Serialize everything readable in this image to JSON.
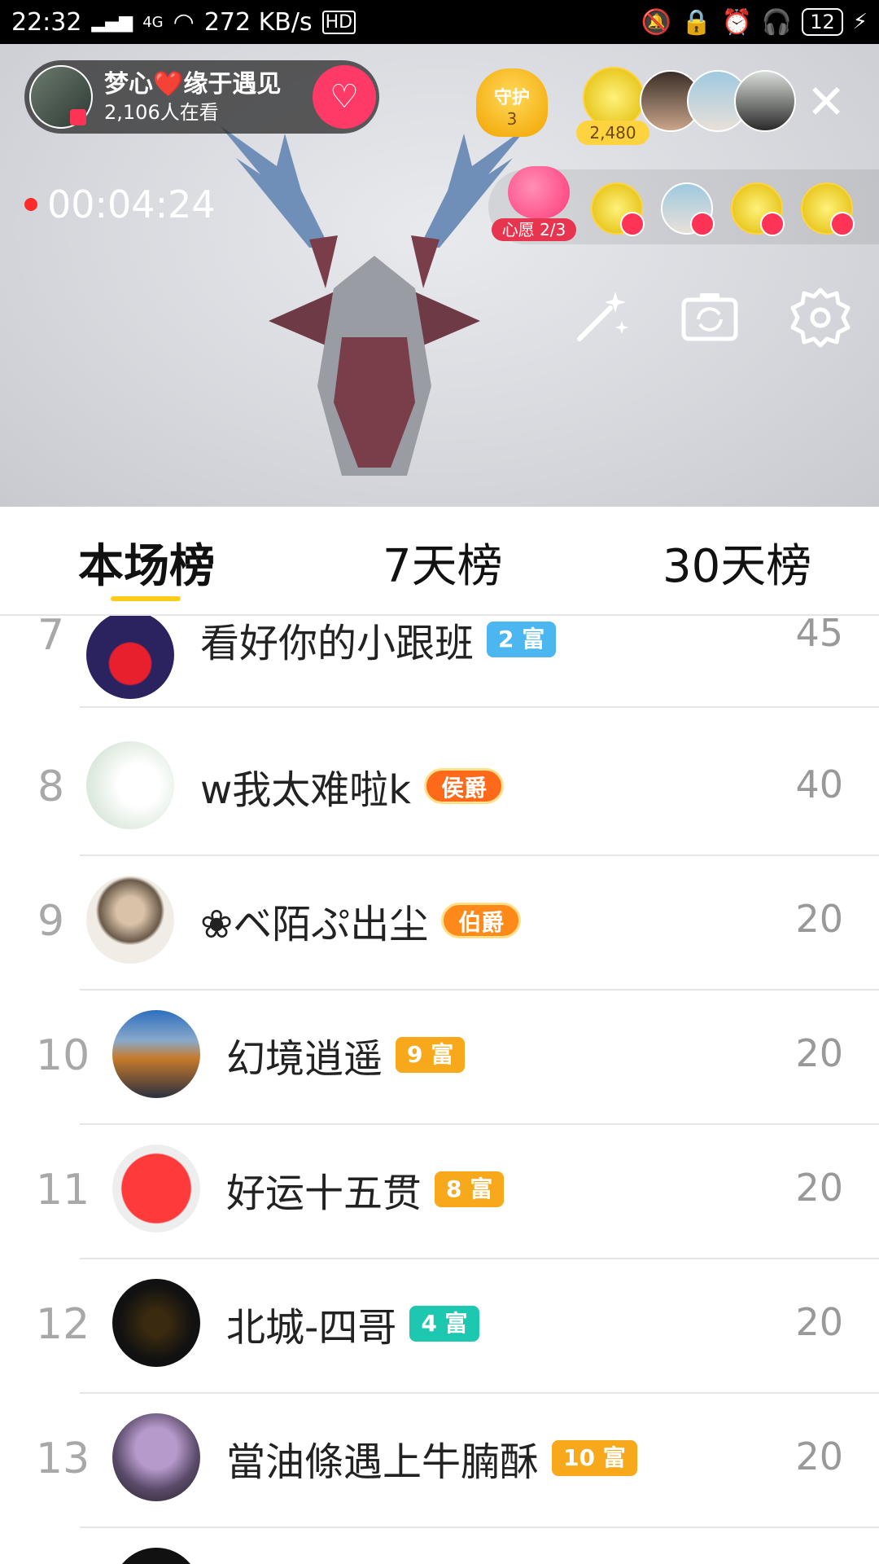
{
  "status_bar": {
    "time": "22:32",
    "network": "4G",
    "speed": "272 KB/s",
    "hd": "HD",
    "battery": "12"
  },
  "live": {
    "host_name": "梦心❤️缘于遇见",
    "viewers": "2,106人在看",
    "guard_label": "守护",
    "guard_count": "3",
    "top_score": "2,480",
    "timer": "00:04:24",
    "wish_label": "心愿 2/3"
  },
  "tabs": [
    {
      "label": "本场榜"
    },
    {
      "label": "7天榜"
    },
    {
      "label": "30天榜"
    }
  ],
  "ranking": [
    {
      "rank": "7",
      "name": "看好你的小跟班",
      "badge": "2 富",
      "badge_color": "#4cb6f0",
      "score": "45"
    },
    {
      "rank": "8",
      "name": "w我太难啦k",
      "badge": "侯爵",
      "badge_color": "#ff6a1a",
      "score": "40"
    },
    {
      "rank": "9",
      "name": "❀ベ陌ぷ出尘",
      "badge": "伯爵",
      "badge_color": "#ff8a1a",
      "score": "20"
    },
    {
      "rank": "10",
      "name": "幻境逍遥",
      "badge": "9 富",
      "badge_color": "#f7a81b",
      "score": "20"
    },
    {
      "rank": "11",
      "name": "好运十五贯",
      "badge": "8 富",
      "badge_color": "#f7a81b",
      "score": "20"
    },
    {
      "rank": "12",
      "name": "北城-四哥",
      "badge": "4 富",
      "badge_color": "#1ec7b0",
      "score": "20"
    },
    {
      "rank": "13",
      "name": "當油條遇上牛腩酥",
      "badge": "10 富",
      "badge_color": "#f7a81b",
      "score": "20"
    }
  ]
}
